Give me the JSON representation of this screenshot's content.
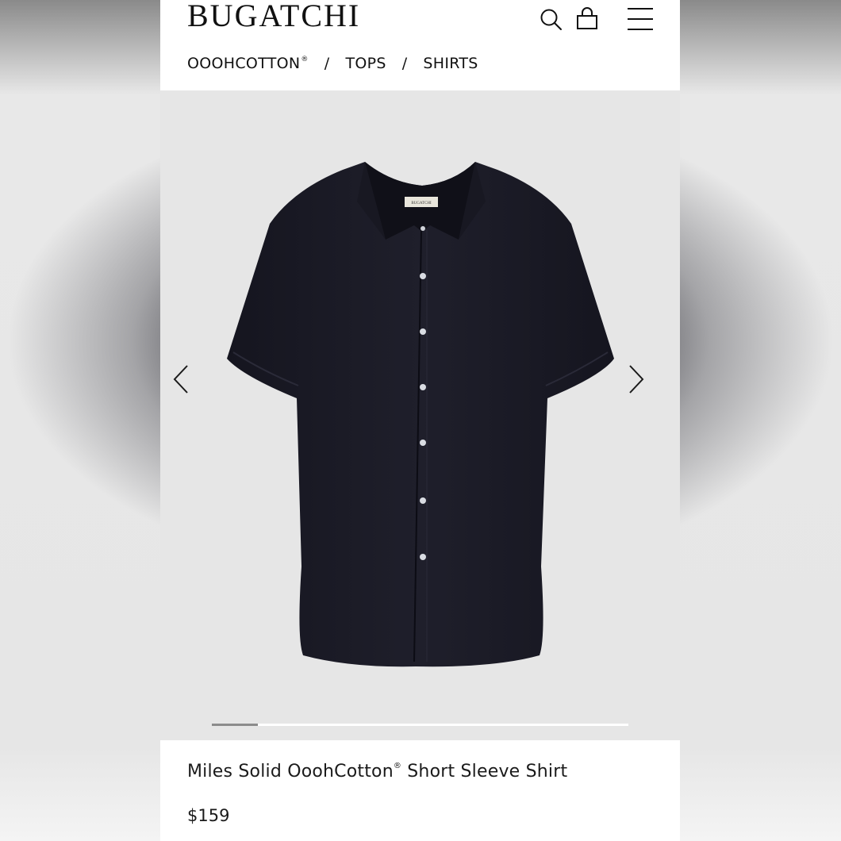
{
  "header": {
    "logo": "BUGATCHI",
    "icons": {
      "search": "search-icon",
      "cart": "cart-icon",
      "menu": "menu-icon"
    }
  },
  "breadcrumb": {
    "items": [
      {
        "label": "OOOHCOTTON",
        "mark": "®"
      },
      {
        "label": "TOPS"
      },
      {
        "label": "SHIRTS"
      }
    ],
    "separator": "/"
  },
  "gallery": {
    "product_label_text": "BUGATCHI",
    "progress": 0.11,
    "colors": {
      "background": "#e6e6e6",
      "shirt": "#1a1a26",
      "track": "#ffffff",
      "fill": "#8c8c8c"
    }
  },
  "product": {
    "title_part1": "Miles Solid OoohCotton",
    "title_mark": "®",
    "title_part2": " Short Sleeve Shirt",
    "price": "$159"
  }
}
